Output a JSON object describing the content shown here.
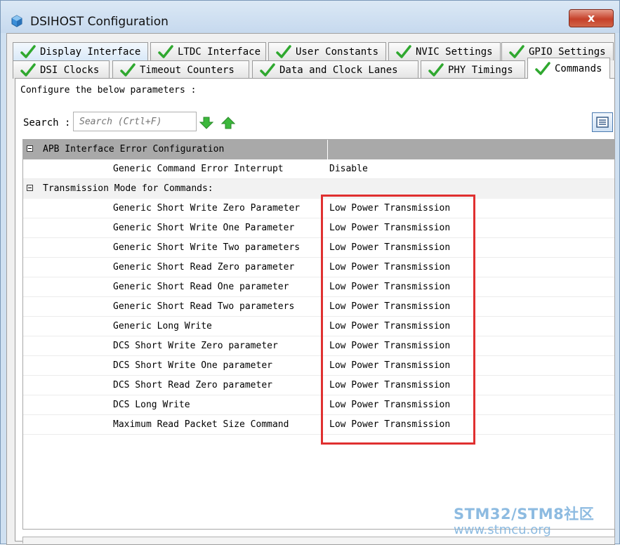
{
  "window": {
    "title": "DSIHOST Configuration",
    "close_label": "x"
  },
  "tabs": [
    {
      "label": "Display Interface",
      "state": "highlighted"
    },
    {
      "label": "LTDC Interface",
      "state": "normal"
    },
    {
      "label": "User Constants",
      "state": "normal"
    },
    {
      "label": "NVIC Settings",
      "state": "normal"
    },
    {
      "label": "GPIO Settings",
      "state": "normal"
    },
    {
      "label": "DSI Clocks",
      "state": "normal"
    },
    {
      "label": "Timeout Counters",
      "state": "normal"
    },
    {
      "label": "Data and Clock Lanes",
      "state": "normal"
    },
    {
      "label": "PHY Timings",
      "state": "normal"
    },
    {
      "label": "Commands",
      "state": "active"
    }
  ],
  "panel": {
    "description": "Configure the below parameters :",
    "search_label": "Search :",
    "search_placeholder": "Search (Crtl+F)"
  },
  "sections": [
    {
      "title": "APB Interface Error Configuration",
      "params": [
        {
          "name": "Generic Command Error Interrupt",
          "value": "Disable"
        }
      ]
    },
    {
      "title": "Transmission Mode for Commands:",
      "params": [
        {
          "name": "Generic Short Write Zero Parameter",
          "value": "Low Power Transmission"
        },
        {
          "name": "Generic Short Write One Parameter",
          "value": "Low Power Transmission"
        },
        {
          "name": "Generic Short Write Two parameters",
          "value": "Low Power Transmission"
        },
        {
          "name": "Generic Short Read Zero parameter",
          "value": "Low Power Transmission"
        },
        {
          "name": "Generic Short Read One parameter",
          "value": "Low Power Transmission"
        },
        {
          "name": "Generic Short Read Two parameters",
          "value": "Low Power Transmission"
        },
        {
          "name": "Generic Long Write",
          "value": "Low Power Transmission"
        },
        {
          "name": "DCS Short Write Zero parameter",
          "value": "Low Power Transmission"
        },
        {
          "name": "DCS Short Write One parameter",
          "value": "Low Power Transmission"
        },
        {
          "name": "DCS Short Read Zero parameter",
          "value": "Low Power Transmission"
        },
        {
          "name": "DCS Long Write",
          "value": "Low Power Transmission"
        },
        {
          "name": "Maximum Read Packet Size Command",
          "value": "Low Power Transmission"
        }
      ]
    }
  ],
  "watermark": {
    "line1": "STM32/STM8社区",
    "line2": "www.stmcu.org"
  },
  "colors": {
    "check_green": "#2fa82f",
    "arrow_green": "#3cb83c",
    "highlight_red": "#e03030",
    "section_dark": "#a9a9a9"
  }
}
